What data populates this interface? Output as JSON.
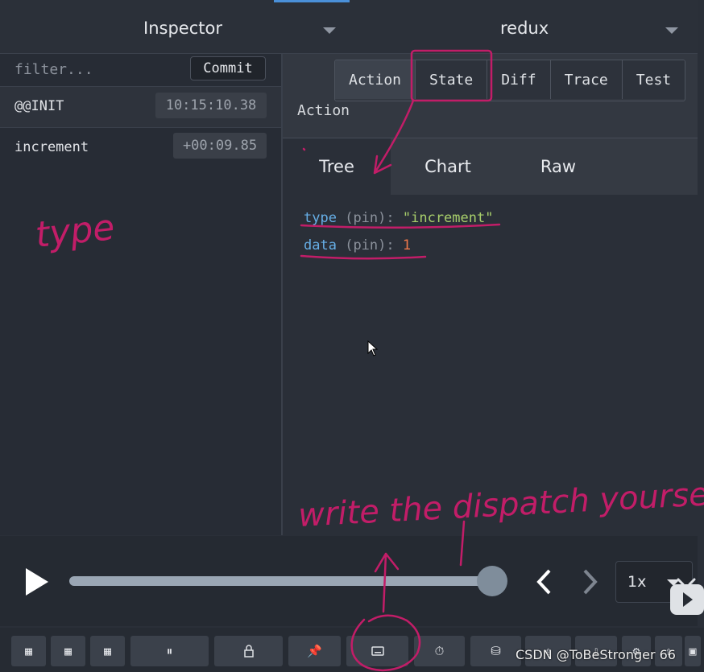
{
  "header": {
    "inspector_title": "Inspector",
    "store_title": "redux"
  },
  "left": {
    "filter_placeholder": "filter...",
    "commit_label": "Commit",
    "actions": [
      {
        "name": "@@INIT",
        "time": "10:15:10.38"
      },
      {
        "name": "increment",
        "time": "+00:09.85"
      }
    ]
  },
  "right": {
    "tabs": [
      "Action",
      "State",
      "Diff",
      "Trace",
      "Test"
    ],
    "active_tab": "Action",
    "section_label": "Action",
    "subtabs": [
      "Tree",
      "Chart",
      "Raw"
    ],
    "active_subtab": "Tree",
    "tree": [
      {
        "key": "type",
        "meta": "(pin):",
        "value": "\"increment\"",
        "kind": "string"
      },
      {
        "key": "data",
        "meta": "(pin):",
        "value": "1",
        "kind": "number"
      }
    ]
  },
  "player": {
    "progress": 1.0,
    "speed": "1x"
  },
  "annotations": {
    "type_note": "type",
    "dispatch_note": "write the dispatch yourself"
  },
  "watermark": "CSDN @ToBeStronger 66",
  "colors": {
    "annotation": "#c21d68",
    "key": "#66aee6",
    "string": "#a8cf6b",
    "number": "#f0784a",
    "accent": "#4a90d9"
  },
  "icons": {
    "toolbar": [
      "grid-left-icon",
      "grid-center-icon",
      "grid-right-icon",
      "pause-icon",
      "lock-icon",
      "pin-icon",
      "keyboard-icon",
      "timer-icon",
      "persist-icon",
      "share-icon",
      "import-icon",
      "settings-icon",
      "export-icon",
      "remote-icon"
    ]
  }
}
